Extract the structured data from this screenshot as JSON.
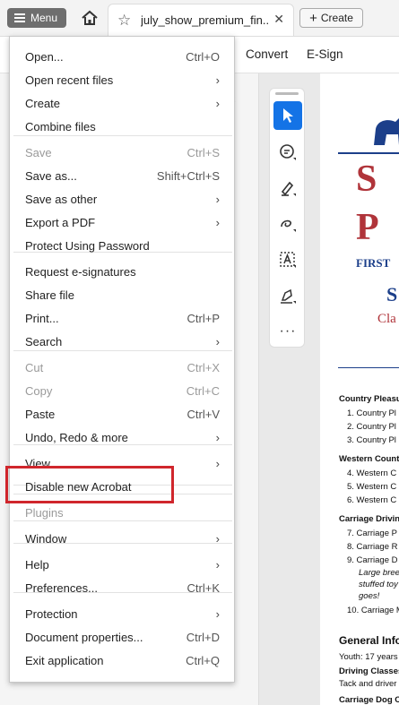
{
  "topbar": {
    "menu_label": "Menu",
    "tab_title": "july_show_premium_fin...",
    "create_label": "Create"
  },
  "secondary": {
    "convert": "Convert",
    "esign": "E-Sign"
  },
  "menu": {
    "items": [
      {
        "label": "Open...",
        "shortcut": "Ctrl+O"
      },
      {
        "label": "Open recent files",
        "submenu": true
      },
      {
        "label": "Create",
        "submenu": true
      },
      {
        "label": "Combine files"
      },
      {
        "label": "Save",
        "shortcut": "Ctrl+S",
        "disabled": true
      },
      {
        "label": "Save as...",
        "shortcut": "Shift+Ctrl+S"
      },
      {
        "label": "Save as other",
        "submenu": true
      },
      {
        "label": "Export a PDF",
        "submenu": true
      },
      {
        "label": "Protect Using Password"
      },
      {
        "label": "Request e-signatures"
      },
      {
        "label": "Share file"
      },
      {
        "label": "Print...",
        "shortcut": "Ctrl+P"
      },
      {
        "label": "Search",
        "submenu": true
      },
      {
        "label": "Cut",
        "shortcut": "Ctrl+X",
        "disabled": true
      },
      {
        "label": "Copy",
        "shortcut": "Ctrl+C",
        "disabled": true
      },
      {
        "label": "Paste",
        "shortcut": "Ctrl+V"
      },
      {
        "label": "Undo, Redo & more",
        "submenu": true
      },
      {
        "label": "View",
        "submenu": true
      },
      {
        "label": "Disable new Acrobat"
      },
      {
        "label": "Plugins",
        "disabled": true
      },
      {
        "label": "Window",
        "submenu": true
      },
      {
        "label": "Help",
        "submenu": true
      },
      {
        "label": "Preferences...",
        "shortcut": "Ctrl+K"
      },
      {
        "label": "Protection",
        "submenu": true
      },
      {
        "label": "Document properties...",
        "shortcut": "Ctrl+D"
      },
      {
        "label": "Exit application",
        "shortcut": "Ctrl+Q"
      }
    ]
  },
  "tools": [
    "select-icon",
    "comment-icon",
    "highlight-icon",
    "draw-icon",
    "text-select-icon",
    "sign-icon",
    "more-icon"
  ],
  "document": {
    "logo_line1": "S",
    "logo_line2": "P",
    "first": "FIRST",
    "s": "S",
    "cla": "Cla",
    "lines": [
      {
        "text": "Country Pleasu",
        "bold": true
      },
      {
        "text": "1.   Country Pl"
      },
      {
        "text": "2.   Country Pl"
      },
      {
        "text": "3.   Country Pl"
      },
      {
        "text": "Western Count",
        "bold": true
      },
      {
        "text": "4.   Western C"
      },
      {
        "text": "5.   Western C"
      },
      {
        "text": "6.   Western C"
      },
      {
        "text": "Carriage Drivin",
        "bold": true
      },
      {
        "text": "7.   Carriage P"
      },
      {
        "text": "8.   Carriage R"
      },
      {
        "text": "9.   Carriage D"
      },
      {
        "text": "Large breed",
        "italic": true
      },
      {
        "text": "stuffed toy",
        "italic": true
      },
      {
        "text": "goes!",
        "italic": true
      },
      {
        "text": "10.  Carriage M"
      },
      {
        "text": "General Info",
        "bold": true
      },
      {
        "text": "Youth: 17 years",
        "youth": true
      },
      {
        "text": "Driving Classes",
        "bold": true
      },
      {
        "text": "Tack and driver"
      },
      {
        "text": "Carriage Dog Cl",
        "bold": true
      }
    ]
  },
  "colors": {
    "accent": "#1473e6",
    "highlight_box": "#d0262c",
    "logo_red": "#b0343a",
    "logo_blue": "#1c3f8a"
  }
}
